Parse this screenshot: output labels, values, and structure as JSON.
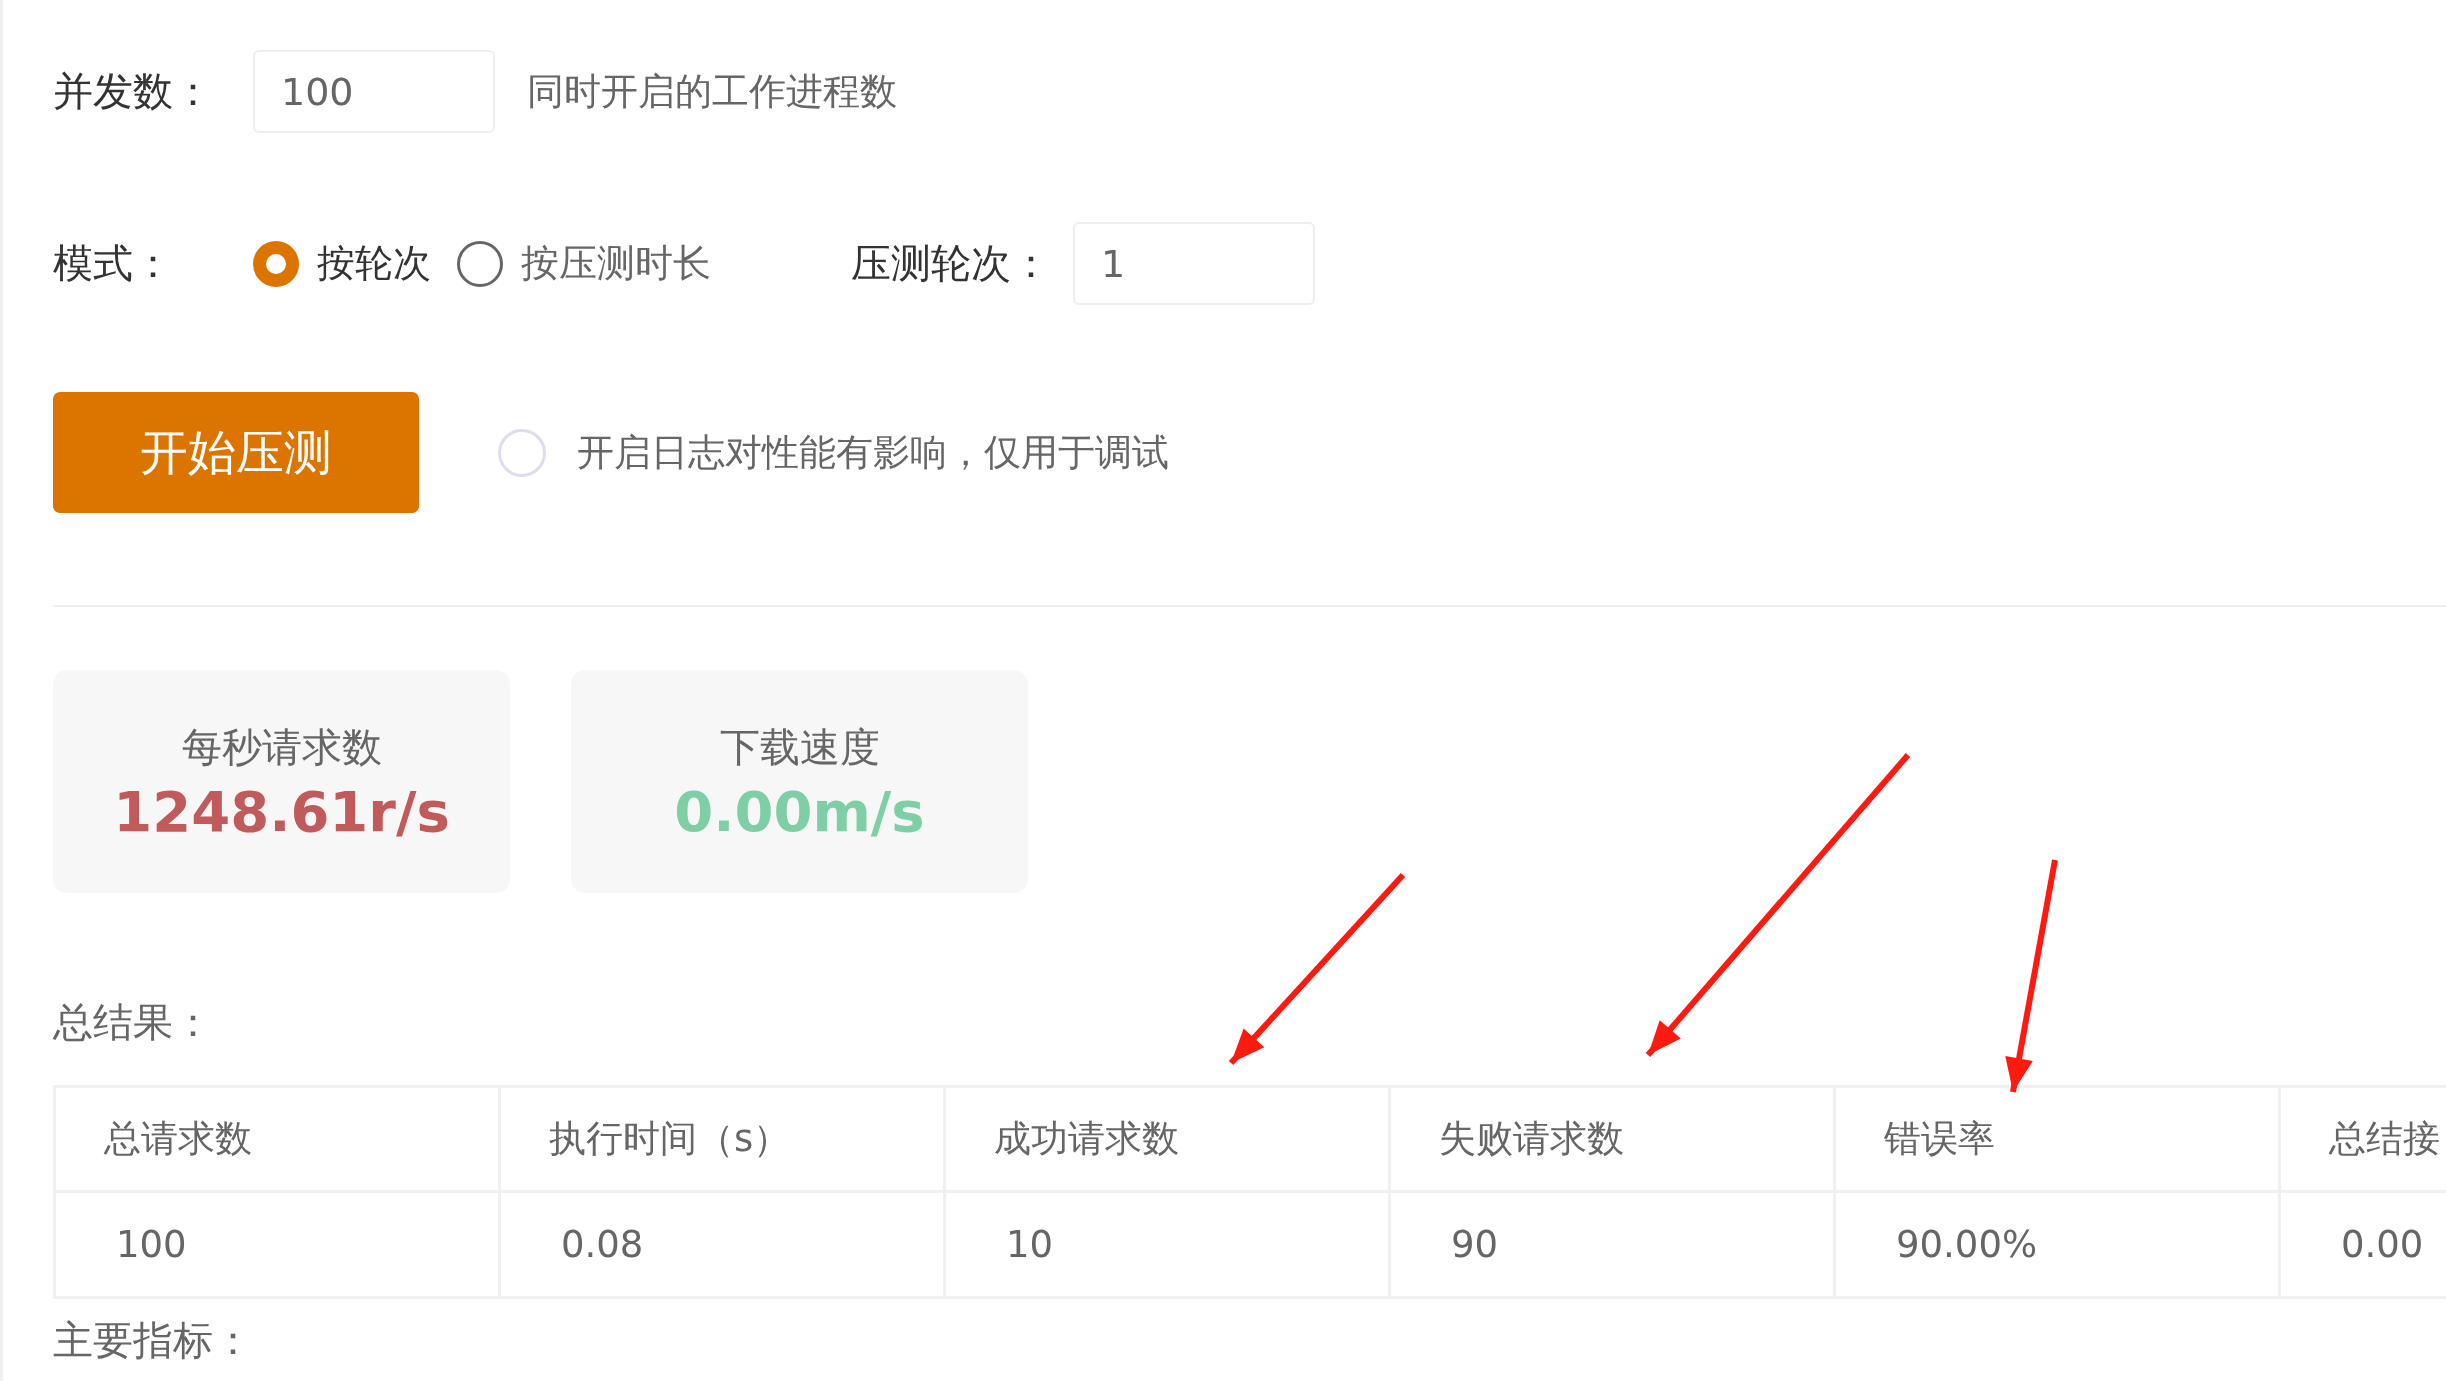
{
  "concurrency": {
    "label": "并发数：",
    "value": "100",
    "hint": "同时开启的工作进程数"
  },
  "mode": {
    "label": "模式：",
    "options": [
      {
        "label": "按轮次",
        "selected": true
      },
      {
        "label": "按压测时长",
        "selected": false
      }
    ],
    "rounds_label": "压测轮次：",
    "rounds_value": "1"
  },
  "start_button": "开始压测",
  "log_option": {
    "label": "开启日志对性能有影响，仅用于调试",
    "checked": false
  },
  "metrics": [
    {
      "label": "每秒请求数",
      "value": "1248.61r/s",
      "color": "#c15b5b"
    },
    {
      "label": "下载速度",
      "value": "0.00m/s",
      "color": "#7fcfa6"
    }
  ],
  "summary_title": "总结果：",
  "table": {
    "columns": [
      "总请求数",
      "执行时间（s）",
      "成功请求数",
      "失败请求数",
      "错误率",
      "总结接"
    ],
    "rows": [
      [
        "100",
        "0.08",
        "10",
        "90",
        "90.00%",
        "0.00"
      ]
    ]
  },
  "indicators_title": "主要指标："
}
